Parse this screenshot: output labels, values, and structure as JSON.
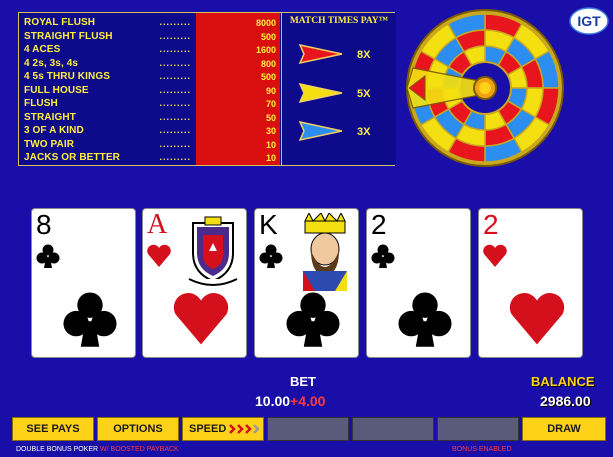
{
  "paytable": {
    "rows": [
      {
        "name": "ROYAL FLUSH",
        "value": "8000"
      },
      {
        "name": "STRAIGHT FLUSH",
        "value": "500"
      },
      {
        "name": "4 ACES",
        "value": "1600"
      },
      {
        "name": "4 2s, 3s, 4s",
        "value": "800"
      },
      {
        "name": "4 5s THRU KINGS",
        "value": "500"
      },
      {
        "name": "FULL HOUSE",
        "value": "90"
      },
      {
        "name": "FLUSH",
        "value": "70"
      },
      {
        "name": "STRAIGHT",
        "value": "50"
      },
      {
        "name": "3 OF A KIND",
        "value": "30"
      },
      {
        "name": "TWO PAIR",
        "value": "10"
      },
      {
        "name": "JACKS OR BETTER",
        "value": "10"
      }
    ],
    "dots": ".........",
    "match_title": "MATCH TIMES PAY™",
    "multipliers": [
      {
        "label": "8X",
        "color": "#e8141e"
      },
      {
        "label": "5X",
        "color": "#f4e010"
      },
      {
        "label": "3X",
        "color": "#2c8ef0"
      }
    ]
  },
  "logo": "IGT",
  "cards": [
    {
      "rank": "8",
      "suit": "clubs",
      "color": "#000000"
    },
    {
      "rank": "A",
      "suit": "hearts",
      "color": "#d4101c"
    },
    {
      "rank": "K",
      "suit": "clubs",
      "color": "#000000"
    },
    {
      "rank": "2",
      "suit": "clubs",
      "color": "#000000"
    },
    {
      "rank": "2",
      "suit": "hearts",
      "color": "#d4101c"
    }
  ],
  "bet": {
    "label": "BET",
    "base": "10.00",
    "extra": "+4.00"
  },
  "balance": {
    "label": "BALANCE",
    "value": "2986.00"
  },
  "buttons": {
    "see_pays": "SEE PAYS",
    "options": "OPTIONS",
    "speed": "SPEED",
    "draw": "DRAW"
  },
  "footer": {
    "game": "DOUBLE BONUS POKER",
    "boost": "W/ BOOSTED PAYBACK",
    "bonus": "BONUS ENABLED"
  },
  "colors": {
    "background": "#1a0ea8",
    "paytable_red": "#d90f0f",
    "gold": "#ffd21a",
    "wheel_red": "#e8141e",
    "wheel_yellow": "#f4e010",
    "wheel_blue": "#2c8ef0"
  }
}
